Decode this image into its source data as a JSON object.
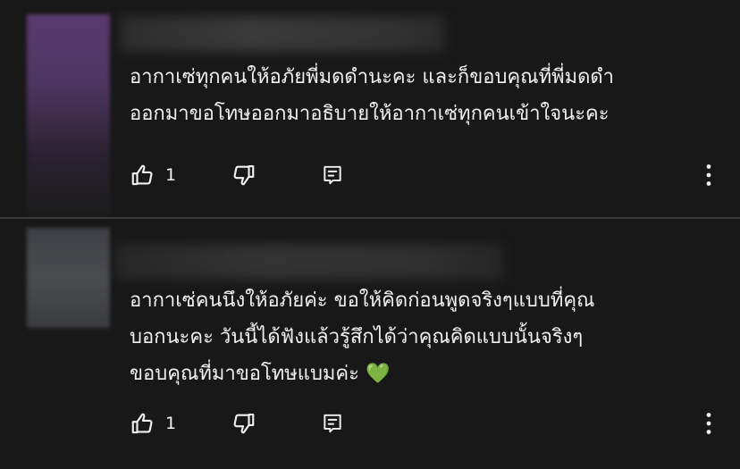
{
  "comments": [
    {
      "author_hidden": true,
      "text_lines": [
        "อากาเซ่ทุกคนให้อภัยพี่มดดำนะคะ และก็ขอบคุณที่พี่มดดำ",
        "ออกมาขอโทษออกมาอธิบายให้อากาเซ่ทุกคนเข้าใจนะคะ"
      ],
      "like_count": "1",
      "icons": {
        "like": "thumbs-up-icon",
        "dislike": "thumbs-down-icon",
        "reply": "reply-icon",
        "more": "more-vertical-icon"
      }
    },
    {
      "author_hidden": true,
      "text_lines": [
        "อากาเซ่คนนึงให้อภัยค่ะ ขอให้คิดก่อนพูดจริงๆแบบที่คุณ",
        "บอกนะคะ วันนี้ได้ฟังแล้วรู้สึกได้ว่าคุณคิดแบบนั้นจริงๆ",
        "ขอบคุณที่มาขอโทษแบมค่ะ 💚"
      ],
      "like_count": "1",
      "icons": {
        "like": "thumbs-up-icon",
        "dislike": "thumbs-down-icon",
        "reply": "reply-icon",
        "more": "more-vertical-icon"
      }
    }
  ],
  "colors": {
    "background": "#181818",
    "text": "#f1f1f1",
    "divider": "#3a3a3a"
  }
}
